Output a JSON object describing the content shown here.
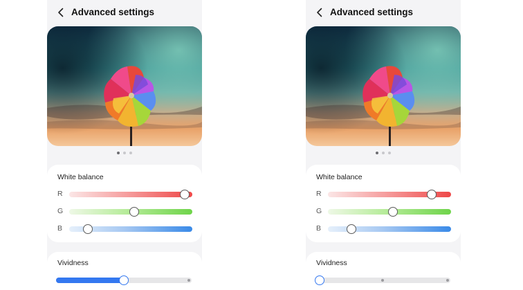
{
  "screens": [
    {
      "title": "Advanced settings",
      "page_dots": {
        "count": 3,
        "active": 0
      },
      "white_balance": {
        "title": "White balance",
        "sliders": [
          {
            "label": "R",
            "value": 0.94,
            "color": "#ee4848"
          },
          {
            "label": "G",
            "value": 0.53,
            "color": "#6fd44a"
          },
          {
            "label": "B",
            "value": 0.15,
            "color": "#3a8ae8"
          }
        ]
      },
      "vividness": {
        "title": "Vividness",
        "value": 0.5,
        "steps": 3,
        "accent": "#3478f0"
      }
    },
    {
      "title": "Advanced settings",
      "page_dots": {
        "count": 3,
        "active": 0
      },
      "white_balance": {
        "title": "White balance",
        "sliders": [
          {
            "label": "R",
            "value": 0.84,
            "color": "#ee4848"
          },
          {
            "label": "G",
            "value": 0.53,
            "color": "#6fd44a"
          },
          {
            "label": "B",
            "value": 0.19,
            "color": "#3a8ae8"
          }
        ]
      },
      "vividness": {
        "title": "Vividness",
        "value": 0.0,
        "steps": 3,
        "accent": "#3478f0"
      }
    }
  ],
  "icons": {
    "back": "chevron-left-icon",
    "preview": "pinwheel-image"
  }
}
